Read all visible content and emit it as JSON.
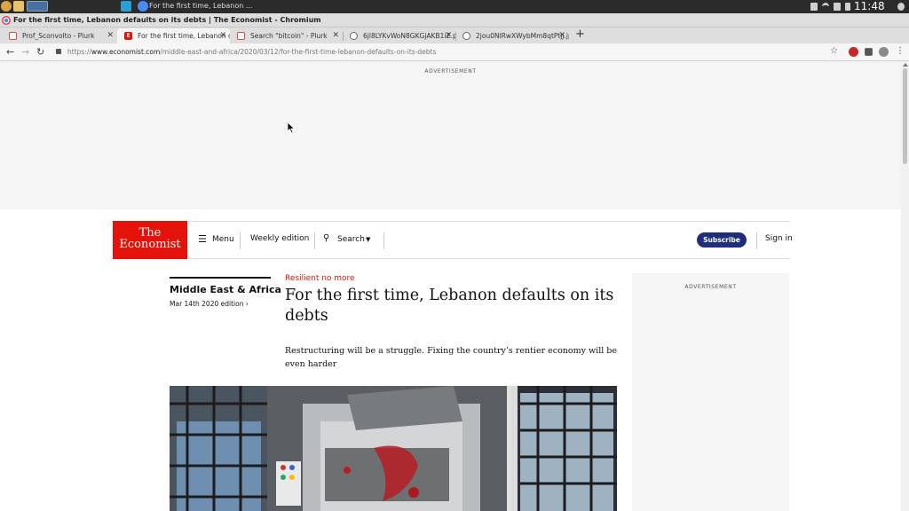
{
  "taskbar": {
    "task_title": "For the first time, Lebanon ...",
    "clock": "11:48"
  },
  "window": {
    "title": "For the first time, Lebanon defaults on its debts | The Economist - Chromium"
  },
  "tabs": [
    {
      "label": "Prof_Sconvolto - Plurk",
      "favicon": "plurk-icon",
      "active": false
    },
    {
      "label": "For the first time, Lebanon de",
      "favicon": "economist-icon",
      "active": true
    },
    {
      "label": "Search \"bitcoin\" - Plurk",
      "favicon": "plurk-icon",
      "active": false
    },
    {
      "label": "6jl8LYKvWoN8GKGjAKB1iZ.png",
      "favicon": "globe-icon",
      "active": false
    },
    {
      "label": "2jou0NlRwXWybMm8qtPtjj.jpg",
      "favicon": "globe-icon",
      "active": false
    }
  ],
  "address": {
    "scheme": "https://",
    "host": "www.economist.com",
    "path": "/middle-east-and-africa/2020/03/12/for-the-first-time-lebanon-defaults-on-its-debts"
  },
  "page": {
    "ad_label_top": "ADVERTISEMENT",
    "ad_label_side": "ADVERTISEMENT",
    "logo_line1": "The",
    "logo_line2": "Economist",
    "nav": {
      "menu": "Menu",
      "weekly": "Weekly edition",
      "search": "Search",
      "subscribe": "Subscribe",
      "signin": "Sign in"
    },
    "section": "Middle East & Africa",
    "edition": "Mar 14th 2020 edition",
    "rubric": "Resilient no more",
    "headline": "For the first time, Lebanon defaults on its debts",
    "standfirst": "Restructuring will be a struggle. Fixing the country’s rentier economy will be even harder"
  },
  "colors": {
    "brand_red": "#e3120b",
    "subscribe_navy": "#1f2e7a"
  }
}
